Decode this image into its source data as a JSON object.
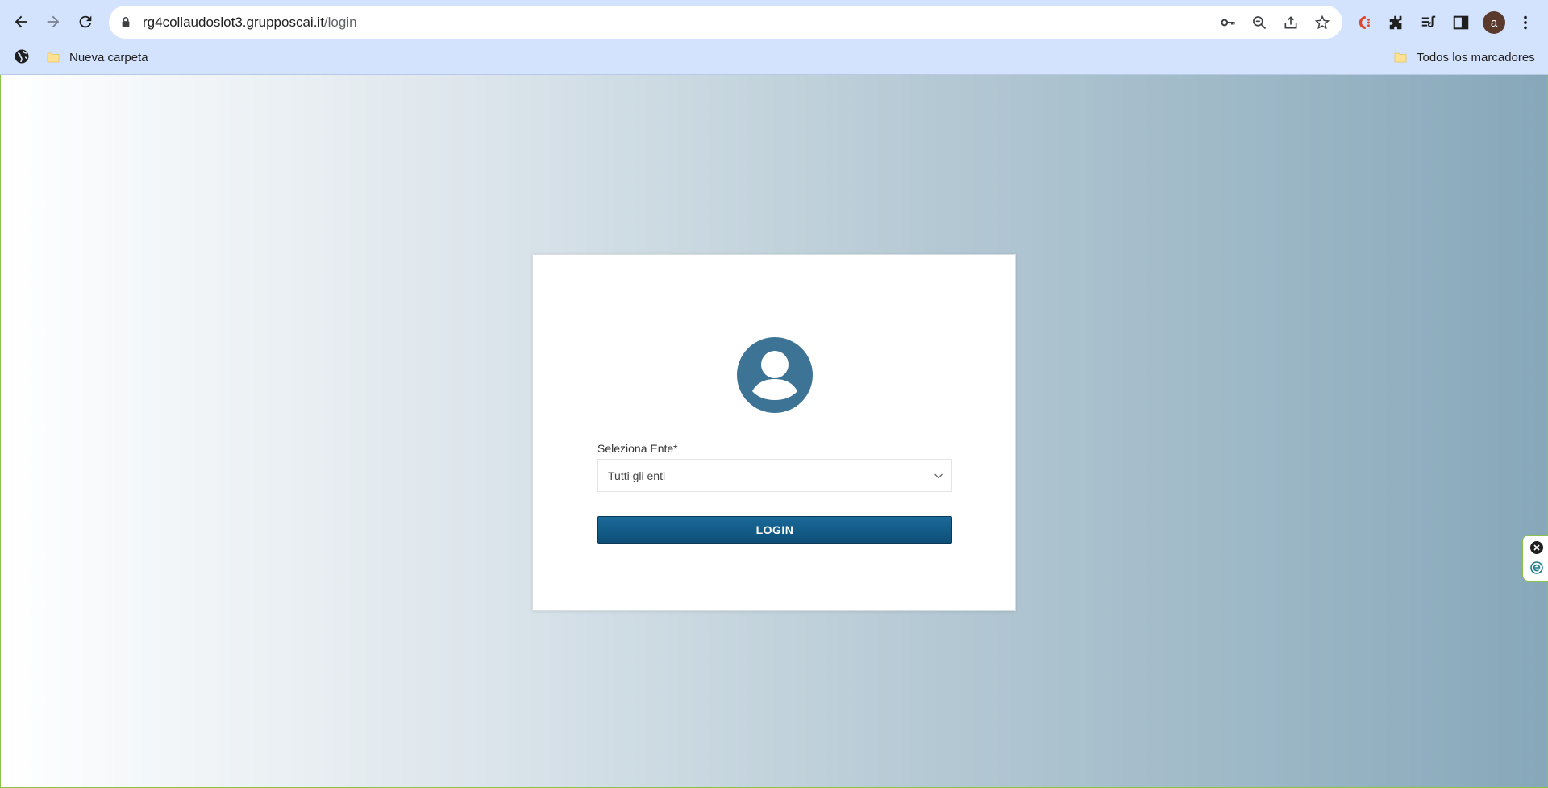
{
  "browser": {
    "url_host": "rg4collaudoslot3.grupposcai.it",
    "url_path": "/login",
    "avatar_letter": "a"
  },
  "bookmarks": {
    "left_folder": "Nueva carpeta",
    "right_folder": "Todos los marcadores"
  },
  "login": {
    "field_label": "Seleziona Ente*",
    "select_value": "Tutti gli enti",
    "button_label": "LOGIN"
  },
  "colors": {
    "accent": "#0f5a87",
    "avatar_icon": "#3d7394"
  }
}
